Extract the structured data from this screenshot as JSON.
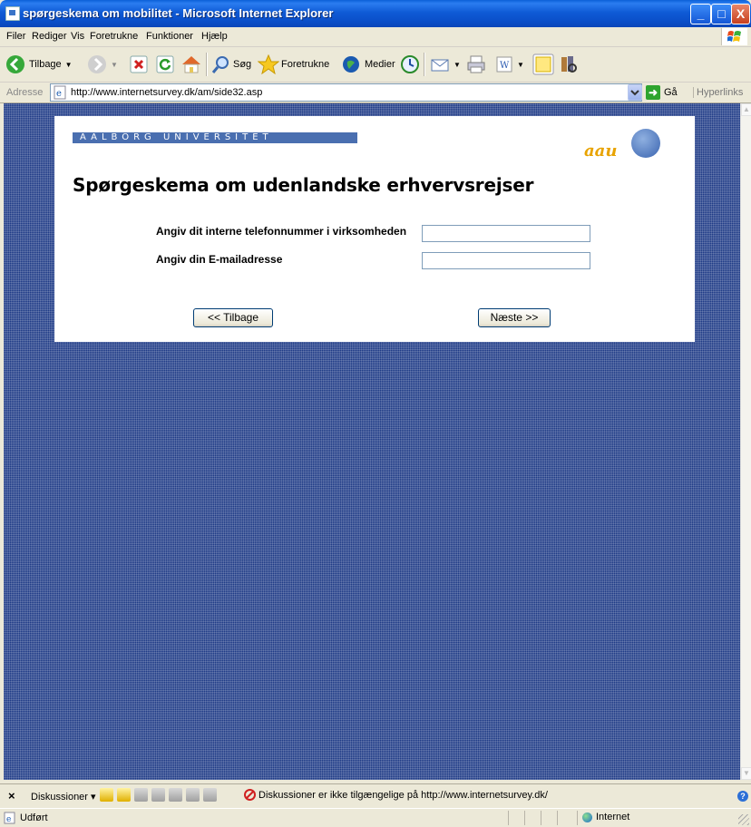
{
  "window": {
    "title": "spørgeskema om mobilitet - Microsoft Internet Explorer",
    "minimize": "_",
    "maximize": "□",
    "close": "X"
  },
  "menu": {
    "items": [
      "Filer",
      "Rediger",
      "Vis",
      "Foretrukne",
      "Funktioner",
      "Hjælp"
    ]
  },
  "toolbar": {
    "back_label": "Tilbage",
    "search_label": "Søg",
    "favorites_label": "Foretrukne",
    "media_label": "Medier"
  },
  "address": {
    "label": "Adresse",
    "url": "http://www.internetsurvey.dk/am/side32.asp",
    "go_label": "Gå",
    "links_label": "Hyperlinks"
  },
  "page": {
    "brand_text": "AALBORG UNIVERSITET",
    "logo_text": "aau",
    "title": "Spørgeskema om udenlandske erhvervsrejser",
    "questions": [
      {
        "label": "Angiv dit interne telefonnummer i virksomheden",
        "value": ""
      },
      {
        "label": "Angiv din E-mailadresse",
        "value": ""
      }
    ],
    "back_button": "<< Tilbage",
    "next_button": "Næste >>"
  },
  "discussion": {
    "close": "×",
    "label": "Diskussioner ▾",
    "message": "Diskussioner er ikke tilgængelige på http://www.internetsurvey.dk/"
  },
  "status": {
    "text": "Udført",
    "zone": "Internet"
  },
  "colors": {
    "page_background": "#1e3a86",
    "brand_bar": "#4a6fb0",
    "logo_orange": "#e8a300",
    "titlebar_blue": "#0a5fd8"
  }
}
